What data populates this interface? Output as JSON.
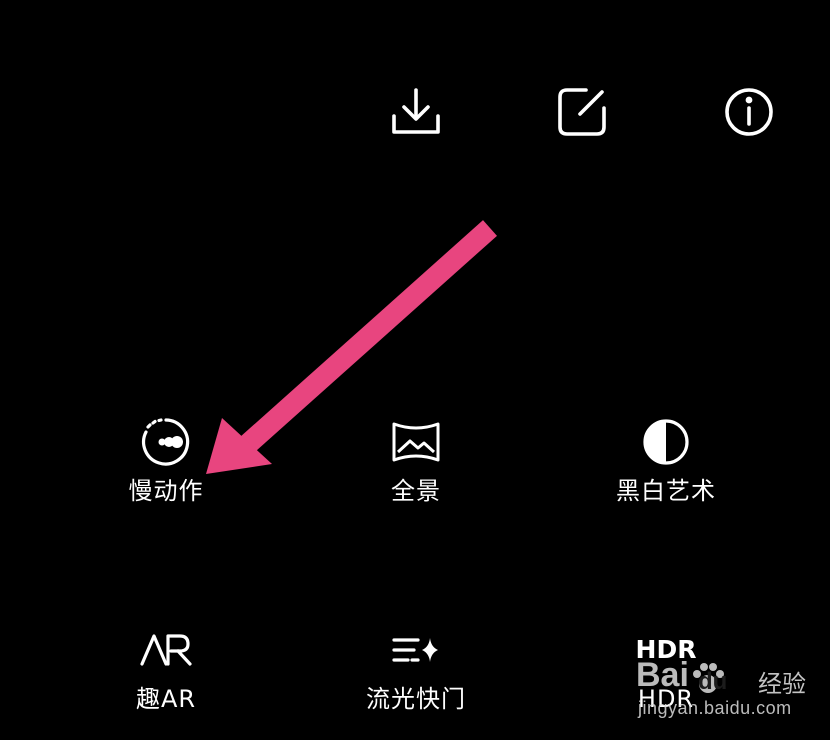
{
  "toolbar": {
    "download_icon": "download-icon",
    "edit_icon": "edit-icon",
    "info_icon": "info-icon"
  },
  "modes": [
    {
      "label": "慢动作",
      "icon": "slow-motion-icon"
    },
    {
      "label": "全景",
      "icon": "panorama-icon"
    },
    {
      "label": "黑白艺术",
      "icon": "bw-art-icon"
    },
    {
      "label": "趣AR",
      "icon": "ar-icon"
    },
    {
      "label": "流光快门",
      "icon": "light-painting-icon"
    },
    {
      "label": "HDR",
      "icon_text": "HDR"
    }
  ],
  "annotation": {
    "arrow_color": "#e8457f"
  },
  "watermark": {
    "brand": "Bai",
    "brand_suffix": "du",
    "jingyan": "经验",
    "url": "jingyan.baidu.com"
  }
}
